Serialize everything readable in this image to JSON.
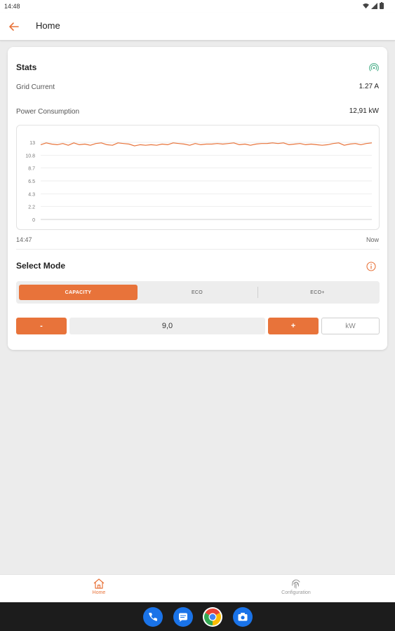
{
  "status_bar": {
    "time": "14:48"
  },
  "app_bar": {
    "title": "Home"
  },
  "stats": {
    "title": "Stats",
    "grid_current_label": "Grid Current",
    "grid_current_value": "1.27 A",
    "power_consumption_label": "Power Consumption",
    "power_consumption_value": "12,91 kW"
  },
  "chart_data": {
    "type": "line",
    "y_ticks": [
      "13",
      "10.8",
      "8.7",
      "6.5",
      "4.3",
      "2.2",
      "0"
    ],
    "ylim": [
      0,
      13
    ],
    "x_start_label": "14:47",
    "x_end_label": "Now",
    "grid": true,
    "color": "#e8733a",
    "values": [
      12.6,
      12.9,
      12.7,
      12.6,
      12.8,
      12.5,
      12.9,
      12.6,
      12.7,
      12.5,
      12.8,
      12.9,
      12.6,
      12.5,
      12.9,
      12.8,
      12.7,
      12.4,
      12.6,
      12.5,
      12.6,
      12.5,
      12.7,
      12.6,
      12.9,
      12.8,
      12.7,
      12.5,
      12.8,
      12.6,
      12.7,
      12.7,
      12.8,
      12.7,
      12.8,
      12.9,
      12.6,
      12.7,
      12.5,
      12.7,
      12.8,
      12.8,
      12.9,
      12.8,
      12.9,
      12.6,
      12.7,
      12.8,
      12.6,
      12.7,
      12.6,
      12.5,
      12.6,
      12.8,
      12.9,
      12.5,
      12.7,
      12.8,
      12.6,
      12.8,
      12.9
    ]
  },
  "mode": {
    "title": "Select Mode",
    "options": [
      "CAPACITY",
      "ECO",
      "ECO+"
    ],
    "selected": "CAPACITY"
  },
  "stepper": {
    "minus_label": "-",
    "value": "9,0",
    "plus_label": "+",
    "unit": "kW"
  },
  "bottom_nav": {
    "items": [
      {
        "label": "Home",
        "icon": "home-icon",
        "active": true
      },
      {
        "label": "Configuration",
        "icon": "fingerprint-icon",
        "active": false
      }
    ]
  },
  "colors": {
    "accent": "#e8733a",
    "wifi": "#4caf8a"
  }
}
